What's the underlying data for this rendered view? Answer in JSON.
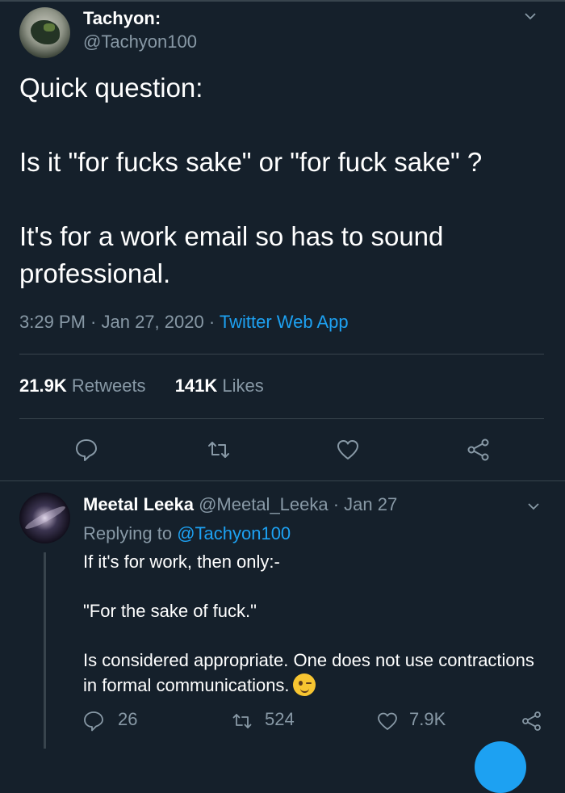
{
  "tweet": {
    "author_name": "Tachyon:",
    "author_handle": "@Tachyon100",
    "lines": [
      "Quick question:",
      "Is it \"for fucks sake\" or \"for fuck sake\" ?",
      "It's for a work email so has to sound professional."
    ],
    "time": "3:29 PM · Jan 27, 2020 · ",
    "source": "Twitter Web App",
    "retweets_count": "21.9K",
    "retweets_label": "Retweets",
    "likes_count": "141K",
    "likes_label": "Likes"
  },
  "icons": {
    "reply": "speech-bubble-icon",
    "retweet": "retweet-arrows-icon",
    "like": "heart-icon",
    "share": "share-nodes-icon",
    "more": "chevron-down-icon"
  },
  "reply": {
    "author_name": "Meetal Leeka",
    "author_handle_date": " @Meetal_Leeka · Jan 27",
    "replying_prefix": "Replying to ",
    "replying_to": "@Tachyon100",
    "line1": "If it's for work, then only:-",
    "line2": "\"For the sake of fuck.\"",
    "line3": "Is considered appropriate. One does not use contractions in formal communications.",
    "emoji": "winking-face-emoji",
    "reply_count": "26",
    "retweet_count": "524",
    "like_count": "7.9K"
  },
  "colors": {
    "background": "#15202b",
    "divider": "#38444d",
    "secondary_text": "#8899a6",
    "accent": "#1da1f2"
  }
}
